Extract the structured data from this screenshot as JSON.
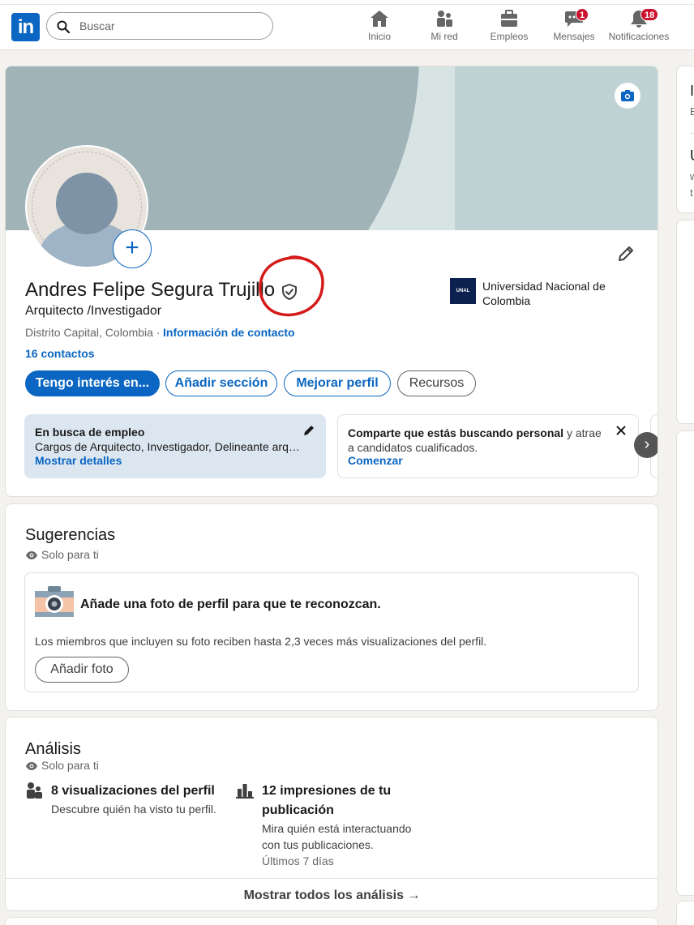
{
  "nav": {
    "search_placeholder": "Buscar",
    "items": [
      {
        "label": "Inicio",
        "icon": "home-icon"
      },
      {
        "label": "Mi red",
        "icon": "people-icon"
      },
      {
        "label": "Empleos",
        "icon": "briefcase-icon"
      },
      {
        "label": "Mensajes",
        "icon": "message-icon",
        "badge": "1"
      },
      {
        "label": "Notificaciones",
        "icon": "bell-icon",
        "badge": "18"
      }
    ]
  },
  "profile": {
    "name": "Andres Felipe Segura Trujillo",
    "headline": "Arquitecto /Investigador",
    "location": "Distrito Capital, Colombia",
    "location_separator": "·",
    "contact_info": "Información de contacto",
    "connections": "16 contactos",
    "education": {
      "logo_text": "UNAL",
      "name": "Universidad Nacional de Colombia"
    },
    "buttons": {
      "open_to": "Tengo interés en...",
      "add_section": "Añadir sección",
      "enhance": "Mejorar perfil",
      "resources": "Recursos"
    },
    "open_to_work": {
      "title": "En busca de empleo",
      "desc": "Cargos de Arquitecto, Investigador, Delineante arquitectónico",
      "link": "Mostrar detalles"
    },
    "hiring": {
      "bold": "Comparte que estás buscando personal",
      "rest": " y atrae a candidatos cualificados.",
      "link": "Comenzar"
    }
  },
  "suggestions": {
    "title": "Sugerencias",
    "private": "Solo para ti",
    "photo_title": "Añade una foto de perfil para que te reconozcan.",
    "photo_desc": "Los miembros que incluyen su foto reciben hasta 2,3 veces más visualizaciones del perfil.",
    "photo_button": "Añadir foto"
  },
  "analytics": {
    "title": "Análisis",
    "private": "Solo para ti",
    "items": [
      {
        "title": "8 visualizaciones del perfil",
        "desc": "Descubre quién ha visto tu perfil."
      },
      {
        "title_1": "12 impresiones de tu",
        "title_2": "publicación",
        "desc_1": "Mira quién está interactuando",
        "desc_2": "con tus publicaciones.",
        "meta": "Últimos 7 días"
      }
    ],
    "show_all": "Mostrar todos los análisis →"
  },
  "right_rail": {
    "card1_line1": "I",
    "card1_line2": "E",
    "card1_line3": "U",
    "card1_line4": "w",
    "card1_line5": "t"
  },
  "colors": {
    "brand": "#0a66c2",
    "badge": "#cb112d",
    "annotation": "#d61a1a"
  }
}
